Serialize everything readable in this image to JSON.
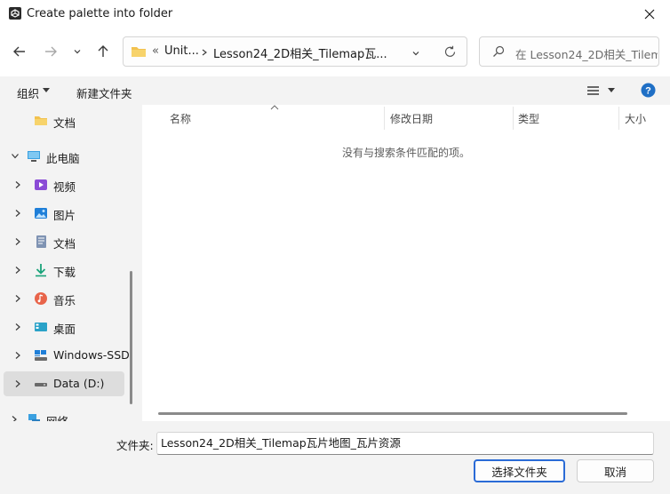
{
  "window": {
    "title": "Create palette into folder"
  },
  "address_bar": {
    "overflow": "«",
    "crumbs": [
      "Unit...",
      "Lesson24_2D相关_Tilemap瓦..."
    ]
  },
  "search": {
    "placeholder": "在 Lesson24_2D相关_Tilem..."
  },
  "toolbar": {
    "organize_label": "组织",
    "new_folder_label": "新建文件夹"
  },
  "nav_tree": {
    "items": [
      {
        "label": "文档",
        "icon": "folder-icon"
      },
      {
        "label": "此电脑",
        "icon": "computer-icon"
      },
      {
        "label": "视频",
        "icon": "video-icon"
      },
      {
        "label": "图片",
        "icon": "pictures-icon"
      },
      {
        "label": "文档",
        "icon": "documents-icon"
      },
      {
        "label": "下载",
        "icon": "download-icon"
      },
      {
        "label": "音乐",
        "icon": "music-icon"
      },
      {
        "label": "桌面",
        "icon": "desktop-icon"
      },
      {
        "label": "Windows-SSD",
        "icon": "drive-icon"
      },
      {
        "label": "Data (D:)",
        "icon": "drive-icon"
      },
      {
        "label": "网络",
        "icon": "network-icon"
      }
    ]
  },
  "columns": {
    "name": "名称",
    "modified": "修改日期",
    "type": "类型",
    "size": "大小"
  },
  "content": {
    "empty_message": "没有与搜索条件匹配的项。"
  },
  "footer": {
    "folder_label": "文件夹:",
    "folder_value": "Lesson24_2D相关_Tilemap瓦片地图_瓦片资源",
    "select_button": "选择文件夹",
    "cancel_button": "取消"
  },
  "colors": {
    "accent": "#2a6bd6",
    "help": "#1f6fc5",
    "folder": "#f2c14e"
  }
}
